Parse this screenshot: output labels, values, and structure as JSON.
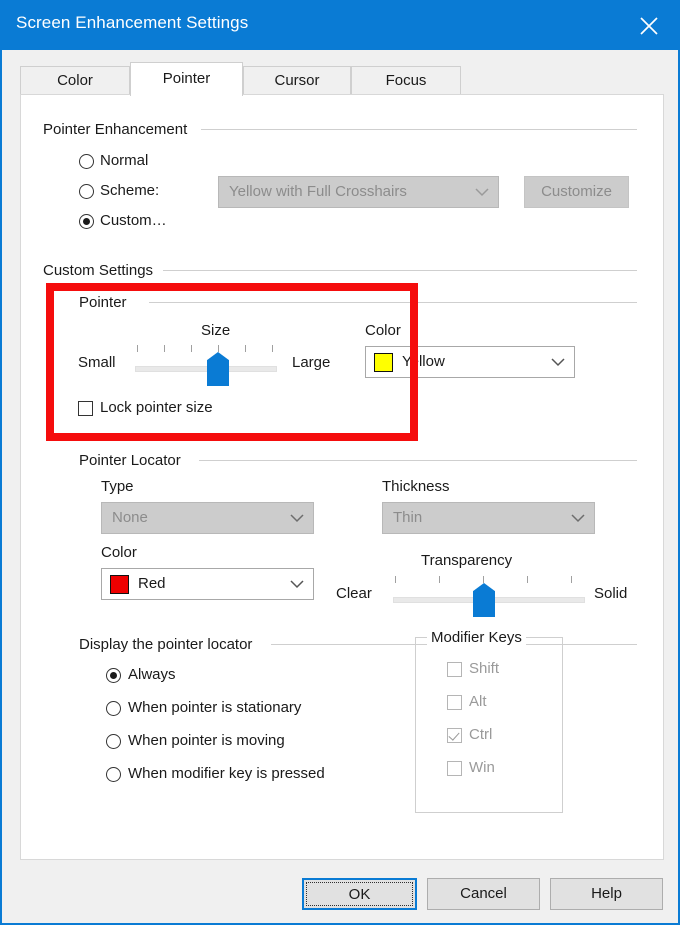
{
  "window": {
    "title": "Screen Enhancement Settings",
    "close_icon": "close-icon",
    "accent_color": "#0a7bd4"
  },
  "tabs": [
    {
      "label": "Color",
      "active": false
    },
    {
      "label": "Pointer",
      "active": true
    },
    {
      "label": "Cursor",
      "active": false
    },
    {
      "label": "Focus",
      "active": false
    }
  ],
  "pointer_enhancement": {
    "group_label": "Pointer Enhancement",
    "options": [
      {
        "label": "Normal",
        "selected": false
      },
      {
        "label": "Scheme:",
        "selected": false
      },
      {
        "label": "Custom…",
        "selected": true
      }
    ],
    "scheme_combo": {
      "value": "Yellow with Full Crosshairs",
      "enabled": false
    },
    "customize_button": {
      "label": "Customize",
      "enabled": false
    }
  },
  "custom_settings": {
    "group_label": "Custom Settings",
    "pointer": {
      "group_label": "Pointer",
      "size": {
        "label": "Size",
        "min_label": "Small",
        "max_label": "Large",
        "ticks": 6,
        "value_index": 3
      },
      "lock_pointer_size": {
        "label": "Lock pointer size",
        "checked": false
      },
      "color": {
        "label": "Color",
        "value": "Yellow",
        "swatch_color": "#ffff00"
      }
    },
    "pointer_locator": {
      "group_label": "Pointer Locator",
      "type": {
        "label": "Type",
        "value": "None",
        "enabled": false
      },
      "thickness": {
        "label": "Thickness",
        "value": "Thin",
        "enabled": false
      },
      "color": {
        "label": "Color",
        "value": "Red",
        "swatch_color": "#ee0000"
      },
      "transparency": {
        "label": "Transparency",
        "min_label": "Clear",
        "max_label": "Solid",
        "ticks": 5,
        "value_index": 2
      }
    },
    "display_locator": {
      "group_label": "Display the pointer locator",
      "options": [
        {
          "label": "Always",
          "selected": true
        },
        {
          "label": "When pointer is stationary",
          "selected": false
        },
        {
          "label": "When pointer is moving",
          "selected": false
        },
        {
          "label": "When modifier key is pressed",
          "selected": false
        }
      ]
    },
    "modifier_keys": {
      "group_label": "Modifier Keys",
      "enabled": false,
      "options": [
        {
          "label": "Shift",
          "checked": false
        },
        {
          "label": "Alt",
          "checked": false
        },
        {
          "label": "Ctrl",
          "checked": true
        },
        {
          "label": "Win",
          "checked": false
        }
      ]
    }
  },
  "footer": {
    "ok_label": "OK",
    "cancel_label": "Cancel",
    "help_label": "Help"
  },
  "annotation": {
    "color": "#f50d0d",
    "shape": "rectangle"
  }
}
